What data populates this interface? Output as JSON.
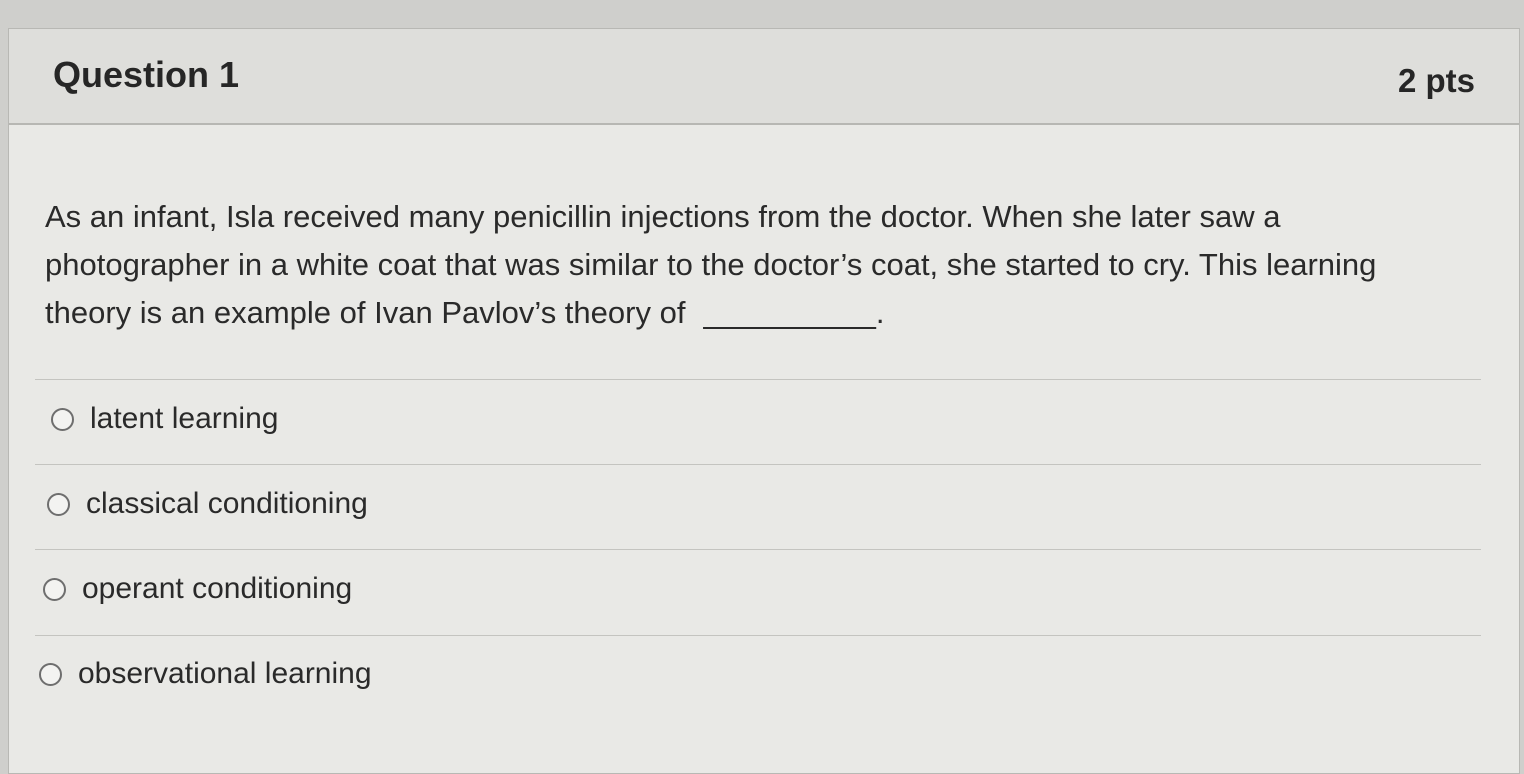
{
  "question": {
    "title": "Question 1",
    "points": "2 pts",
    "text": "As an infant, Isla received many penicillin injections from the doctor. When she later saw a photographer in a white coat that was similar to the doctor’s coat, she started to cry. This learning theory is an example of Ivan Pavlov’s theory of",
    "blank": "__________."
  },
  "answers": [
    {
      "label": "latent learning",
      "selected": false
    },
    {
      "label": "classical conditioning",
      "selected": false
    },
    {
      "label": "operant conditioning",
      "selected": false
    },
    {
      "label": "observational learning",
      "selected": false
    }
  ]
}
